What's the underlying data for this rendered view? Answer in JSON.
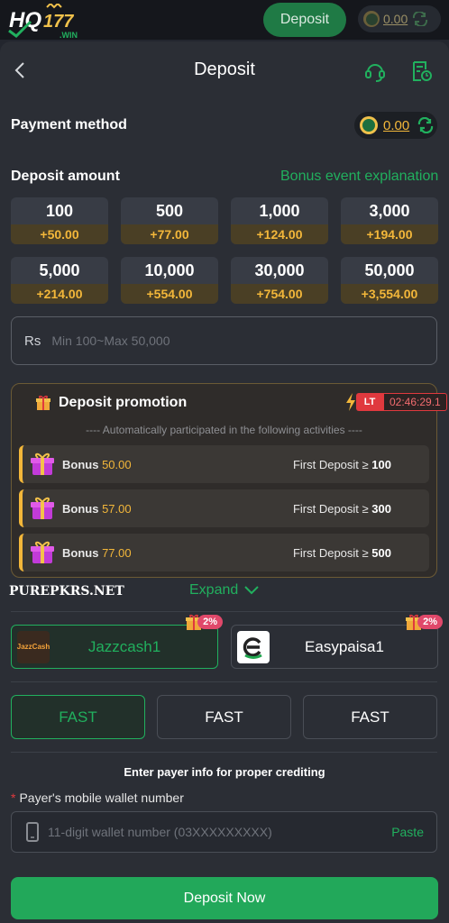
{
  "topbar": {
    "logo_text": "HQ177",
    "logo_sub": ".WIN",
    "deposit_label": "Deposit",
    "balance": "0.00"
  },
  "header": {
    "title": "Deposit"
  },
  "payment_method": {
    "label": "Payment method",
    "balance": "0.00"
  },
  "deposit_amount": {
    "label": "Deposit amount",
    "bonus_link": "Bonus event explanation",
    "options": [
      {
        "value": "100",
        "bonus": "+50.00"
      },
      {
        "value": "500",
        "bonus": "+77.00"
      },
      {
        "value": "1,000",
        "bonus": "+124.00"
      },
      {
        "value": "3,000",
        "bonus": "+194.00"
      },
      {
        "value": "5,000",
        "bonus": "+214.00"
      },
      {
        "value": "10,000",
        "bonus": "+554.00"
      },
      {
        "value": "30,000",
        "bonus": "+754.00"
      },
      {
        "value": "50,000",
        "bonus": "+3,554.00"
      }
    ],
    "currency": "Rs",
    "placeholder": "Min 100~Max 50,000"
  },
  "promotion": {
    "title": "Deposit promotion",
    "lt_label": "LT",
    "timer": "02:46:29.1",
    "subtitle": "---- Automatically participated in the following activities ----",
    "rows": [
      {
        "bonus_label": "Bonus",
        "bonus_value": "50.00",
        "first_label": "First Deposit ≥",
        "threshold": "100"
      },
      {
        "bonus_label": "Bonus",
        "bonus_value": "57.00",
        "first_label": "First Deposit ≥",
        "threshold": "300"
      },
      {
        "bonus_label": "Bonus",
        "bonus_value": "77.00",
        "first_label": "First Deposit ≥",
        "threshold": "500"
      }
    ]
  },
  "watermark": "PUREPKRS.NET",
  "expand_label": "Expand",
  "payment_options": [
    {
      "name": "Jazzcash1",
      "logo_text": "JazzCash",
      "badge": "2%"
    },
    {
      "name": "Easypaisa1",
      "badge": "2%"
    }
  ],
  "channels": [
    "FAST",
    "FAST",
    "FAST"
  ],
  "payer": {
    "note": "Enter payer info for proper crediting",
    "required_mark": "*",
    "wallet_label": "Payer's mobile wallet number",
    "wallet_placeholder": "11-digit wallet number (03XXXXXXXXX)",
    "paste_label": "Paste"
  },
  "cta_label": "Deposit Now",
  "colors": {
    "accent_green": "#21b05e",
    "bonus_gold": "#f3b73a",
    "badge_pink": "#e0486a",
    "timer_red": "#e0393e"
  }
}
